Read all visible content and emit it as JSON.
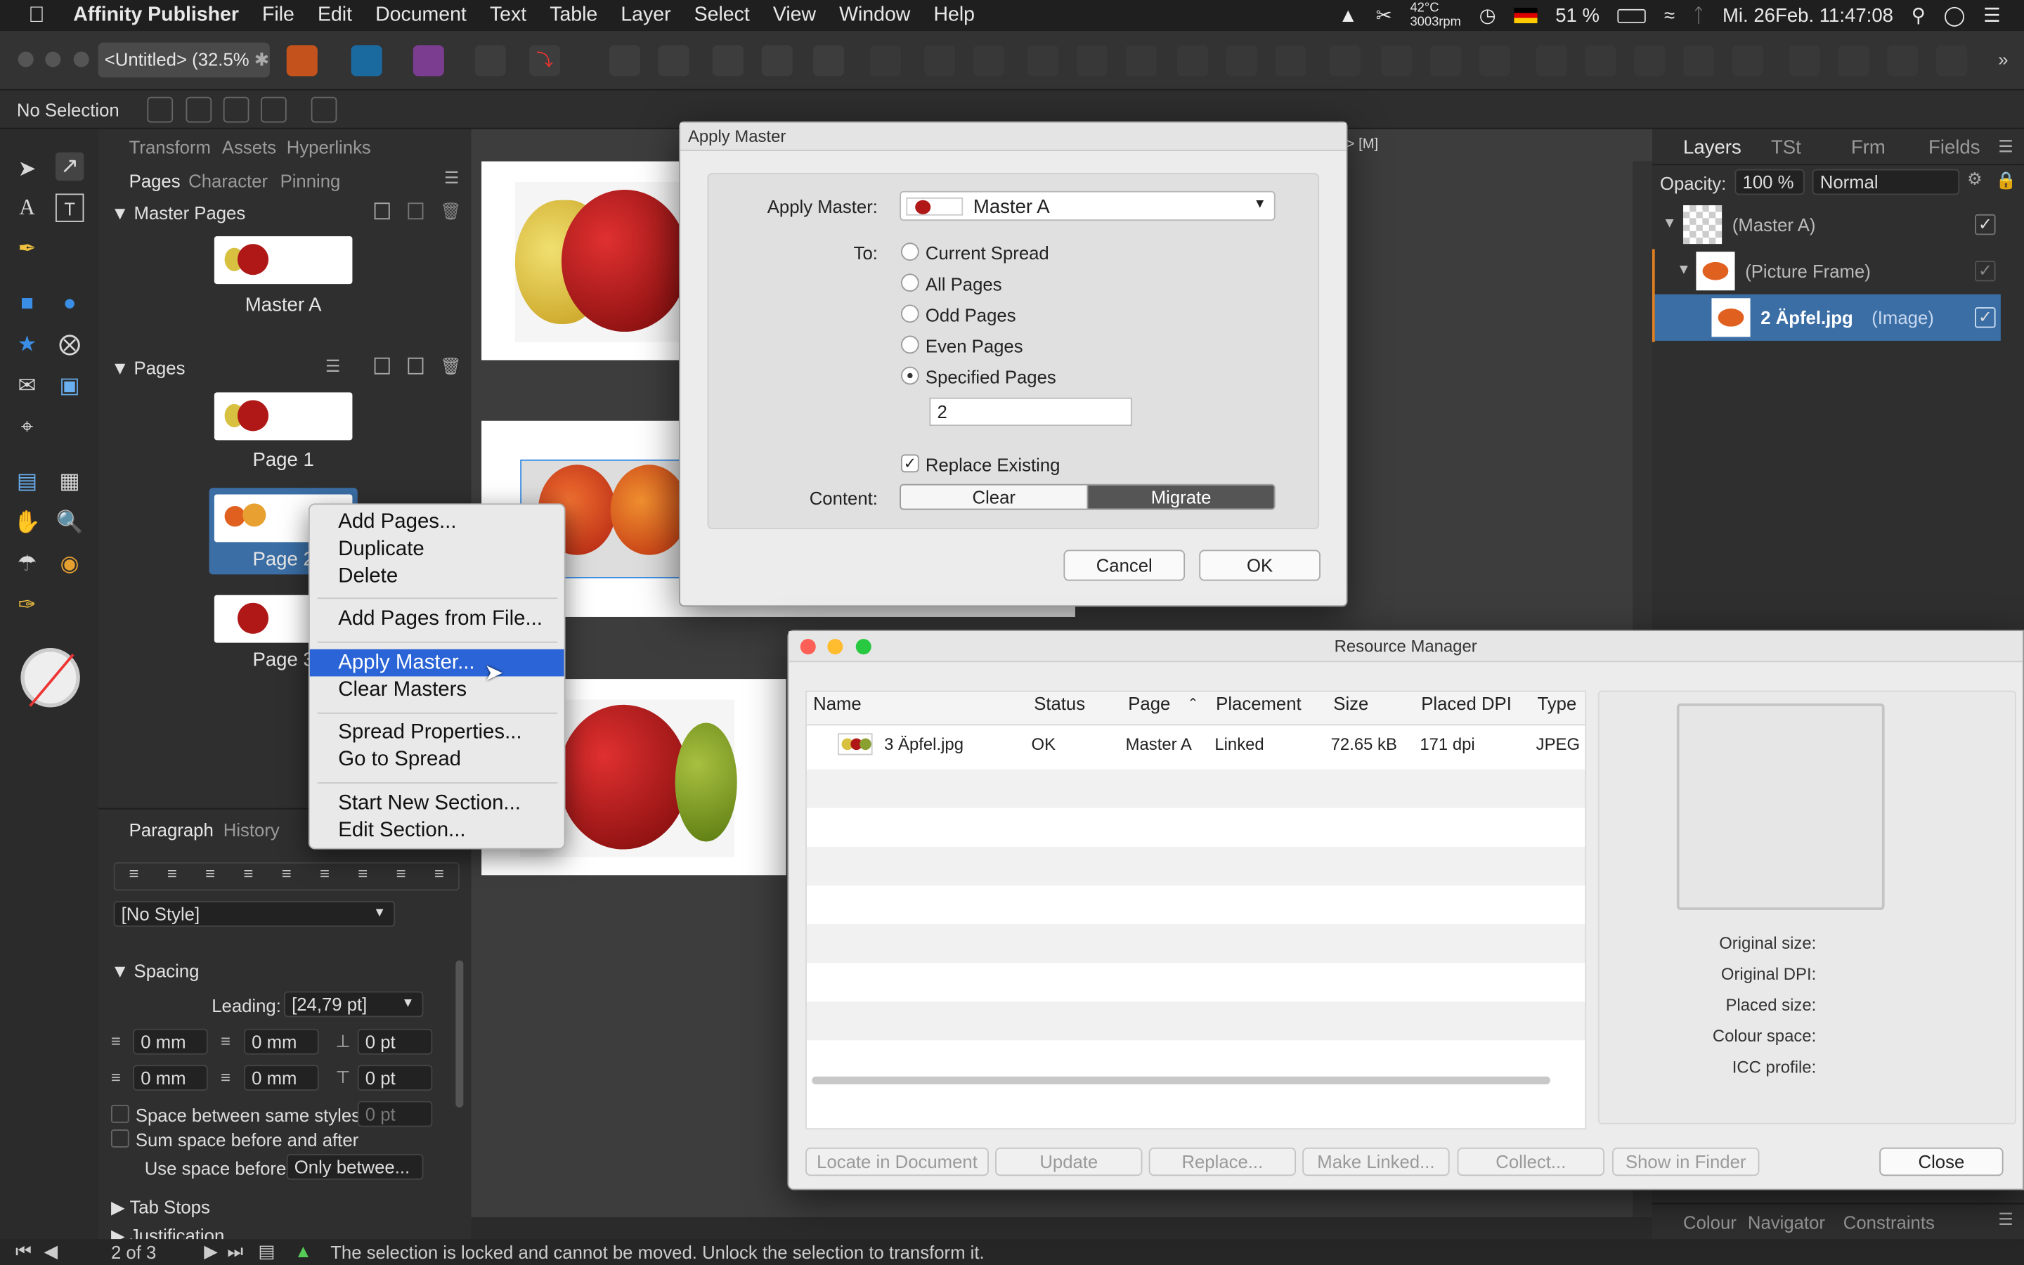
{
  "menubar": {
    "app": "Affinity Publisher",
    "items": [
      "File",
      "Edit",
      "Document",
      "Text",
      "Table",
      "Layer",
      "Select",
      "View",
      "Window",
      "Help"
    ],
    "temp": "42°C",
    "rpm": "3003rpm",
    "battery": "51 %",
    "clock": "Mi. 26Feb.  11:47:08"
  },
  "toolbar": {
    "doc_tab": "<Untitled> (32.5%"
  },
  "contextbar": {
    "selection": "No Selection"
  },
  "leftpanel": {
    "tabs_top": [
      "Transform",
      "Assets",
      "Hyperlinks"
    ],
    "tabs_mid": [
      "Pages",
      "Character",
      "Pinning"
    ],
    "master_pages": "Master Pages",
    "master_label": "Master A",
    "pages": "Pages",
    "page_labels": [
      "Page 1",
      "Page 2",
      "Page 3"
    ],
    "tabs_bottom": [
      "Paragraph",
      "History"
    ],
    "style": "[No Style]",
    "spacing": "Spacing",
    "leading_label": "Leading:",
    "leading_value": "[24,79 pt]",
    "indent_row1": [
      "0 mm",
      "0 mm",
      "0 pt"
    ],
    "indent_row2": [
      "0 mm",
      "0 mm",
      "0 pt"
    ],
    "space_between": "Space between same styles:",
    "space_between_value": "0 pt",
    "sum_space": "Sum space before and after",
    "use_space": "Use space before:",
    "use_space_value": "Only betwee...",
    "tab_stops": "Tab Stops",
    "justification": "Justification"
  },
  "canvas": {
    "ruler_marker": "> [M]"
  },
  "layers": {
    "tabs": [
      "Layers",
      "TSt",
      "Frm",
      "Fields"
    ],
    "opacity_label": "Opacity:",
    "opacity": "100 %",
    "blend": "Normal",
    "rows": [
      {
        "name": "(Master A)",
        "type": ""
      },
      {
        "name": "(Picture Frame)",
        "type": ""
      },
      {
        "name": "2 Äpfel.jpg",
        "type": "(Image)"
      }
    ],
    "bottom_tabs": [
      "Colour",
      "Navigator",
      "Constraints"
    ]
  },
  "statusbar": {
    "page": "2 of 3",
    "message": "The selection is locked and cannot be moved. Unlock the selection to transform it."
  },
  "dialog": {
    "title": "Apply Master",
    "apply_label": "Apply Master:",
    "master": "Master A",
    "to_label": "To:",
    "options": [
      "Current Spread",
      "All Pages",
      "Odd Pages",
      "Even Pages",
      "Specified Pages"
    ],
    "selected_option": "Specified Pages",
    "specified_value": "2",
    "replace_existing": "Replace Existing",
    "content_label": "Content:",
    "content_options": [
      "Clear",
      "Migrate"
    ],
    "content_selected": "Migrate",
    "cancel": "Cancel",
    "ok": "OK"
  },
  "context_menu": {
    "items": [
      "Add Pages...",
      "Duplicate",
      "Delete",
      "Add Pages from File...",
      "Apply Master...",
      "Clear Masters",
      "Spread Properties...",
      "Go to Spread",
      "Start New Section...",
      "Edit Section..."
    ],
    "highlighted": "Apply Master..."
  },
  "resource_manager": {
    "title": "Resource Manager",
    "columns": [
      "Name",
      "Status",
      "Page",
      "Placement",
      "Size",
      "Placed DPI",
      "Type"
    ],
    "rows": [
      {
        "name": "3 Äpfel.jpg",
        "status": "OK",
        "page": "Master A",
        "placement": "Linked",
        "size": "72.65 kB",
        "dpi": "171 dpi",
        "type": "JPEG"
      }
    ],
    "info_labels": [
      "Original size:",
      "Original DPI:",
      "Placed size:",
      "Colour space:",
      "ICC profile:"
    ],
    "buttons": [
      "Locate in Document",
      "Update",
      "Replace...",
      "Make Linked...",
      "Collect...",
      "Show in Finder"
    ],
    "close": "Close"
  },
  "colors": {
    "accent": "#2a64d6",
    "layer_selected": "#3a6ea5",
    "traffic_red": "#fe5f57",
    "traffic_yellow": "#febc2e",
    "traffic_green": "#28c840"
  }
}
